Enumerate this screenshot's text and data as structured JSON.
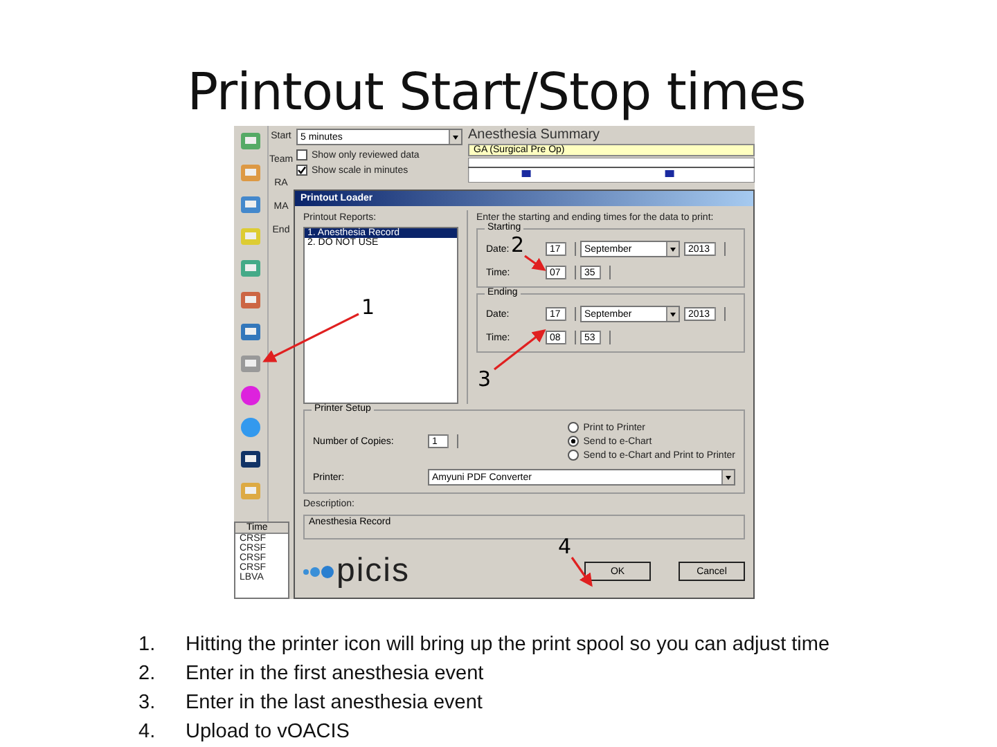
{
  "slide": {
    "title": "Printout Start/Stop times"
  },
  "screenshot": {
    "toolbar_labels": [
      "Start",
      "Team",
      "RA",
      "MA",
      "End"
    ],
    "background_app": {
      "interval": "5 minutes",
      "section_title": "Anesthesia Summary",
      "event": "GA (Surgical Pre Op)",
      "checkboxes": [
        {
          "label": "Show only reviewed data",
          "checked": false
        },
        {
          "label": "Show scale in minutes",
          "checked": true
        }
      ]
    },
    "side_list": {
      "header": "Time",
      "rows": [
        "CRSF",
        "CRSF",
        "CRSF",
        "CRSF",
        "LBVA"
      ]
    },
    "dialog": {
      "title": "Printout Loader",
      "reports_label": "Printout Reports:",
      "reports": [
        {
          "label": "1. Anesthesia Record",
          "selected": true
        },
        {
          "label": "2. DO NOT USE",
          "selected": false
        }
      ],
      "instruction": "Enter the starting and ending times for the data to print:",
      "ranges": [
        {
          "legend": "Starting",
          "date_label": "Date:",
          "day": "17",
          "month": "September",
          "year": "2013",
          "time_label": "Time:",
          "hour": "07",
          "minute": "35"
        },
        {
          "legend": "Ending",
          "date_label": "Date:",
          "day": "17",
          "month": "September",
          "year": "2013",
          "time_label": "Time:",
          "hour": "08",
          "minute": "53"
        }
      ],
      "printer_setup": {
        "legend": "Printer Setup",
        "copies_label": "Number of Copies:",
        "copies": "1",
        "printer_label": "Printer:",
        "printer": "Amyuni PDF Converter",
        "options": [
          {
            "label": "Print to Printer",
            "selected": false
          },
          {
            "label": "Send to e-Chart",
            "selected": true
          },
          {
            "label": "Send to e-Chart and Print to Printer",
            "selected": false
          }
        ]
      },
      "description_label": "Description:",
      "description": "Anesthesia Record",
      "logo": "picis",
      "ok": "OK",
      "cancel": "Cancel"
    },
    "annotations": [
      "1",
      "2",
      "3",
      "4"
    ]
  },
  "steps": [
    {
      "number": "1.",
      "text": "Hitting the printer icon will bring up the print spool so you can adjust time"
    },
    {
      "number": "2.",
      "text": "Enter in the first anesthesia event"
    },
    {
      "number": "3.",
      "text": "Enter in the last anesthesia event"
    },
    {
      "number": "4.",
      "text": "Upload to vOACIS"
    }
  ]
}
